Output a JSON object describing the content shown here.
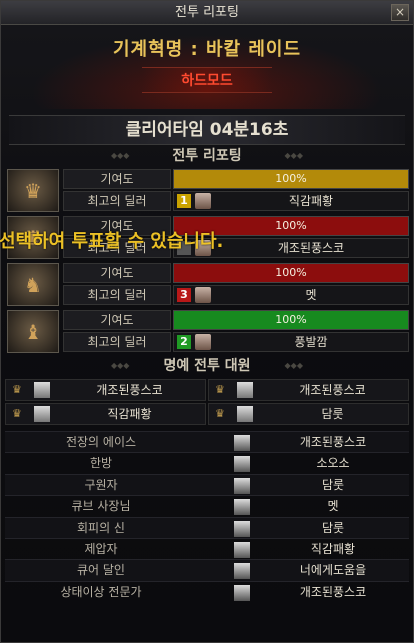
{
  "window": {
    "title": "전투 리포팅",
    "close_label": "×"
  },
  "raid": {
    "name": "기계혁명 : 바칼 레이드",
    "mode": "하드모드"
  },
  "clear_time": "클리어타임  04분16초",
  "section_battle": "전투 리포팅",
  "parties": [
    {
      "contribution_label": "기여도",
      "contribution_pct": "100%",
      "contribution_value": 1.0,
      "bar_color": "#b38a0a",
      "dealer_label": "최고의 딜러",
      "rank": "1",
      "rank_color": "#c9a300",
      "dealer_name": "직감패황",
      "boss_icon": "boss-icon-red",
      "icon_glyph": "♛"
    },
    {
      "contribution_label": "기여도",
      "contribution_pct": "100%",
      "contribution_value": 1.0,
      "bar_color": "#8c0d0d",
      "dealer_label": "최고의 딜러",
      "rank": "",
      "rank_color": "#555555",
      "dealer_name": "개조된풍스코",
      "boss_icon": "boss-icon-gold",
      "icon_glyph": "♜"
    },
    {
      "contribution_label": "기여도",
      "contribution_pct": "100%",
      "contribution_value": 1.0,
      "bar_color": "#8c0d0d",
      "dealer_label": "최고의 딜러",
      "rank": "3",
      "rank_color": "#b81818",
      "dealer_name": "멧",
      "boss_icon": "boss-icon-dark",
      "icon_glyph": "♞"
    },
    {
      "contribution_label": "기여도",
      "contribution_pct": "100%",
      "contribution_value": 1.0,
      "bar_color": "#178a1f",
      "dealer_label": "최고의 딜러",
      "rank": "2",
      "rank_color": "#1f9a24",
      "dealer_name": "풍발깜",
      "boss_icon": "boss-icon-blue",
      "icon_glyph": "♝"
    }
  ],
  "overlay_text": "선택하여 투표할 수 있습니다.",
  "section_honor": "명예 전투 대원",
  "honor_members": [
    {
      "name": "개조된풍스코"
    },
    {
      "name": "개조된풍스코"
    },
    {
      "name": "직감패황"
    },
    {
      "name": "담룻"
    }
  ],
  "awards": [
    {
      "title": "전장의 에이스",
      "name": "개조된풍스코"
    },
    {
      "title": "한방",
      "name": "소오소"
    },
    {
      "title": "구원자",
      "name": "담룻"
    },
    {
      "title": "큐브 사장님",
      "name": "멧"
    },
    {
      "title": "회피의 신",
      "name": "담룻"
    },
    {
      "title": "제압자",
      "name": "직감패황"
    },
    {
      "title": "큐어 달인",
      "name": "너에게도움을"
    },
    {
      "title": "상태이상 전문가",
      "name": "개조된풍스코"
    }
  ]
}
